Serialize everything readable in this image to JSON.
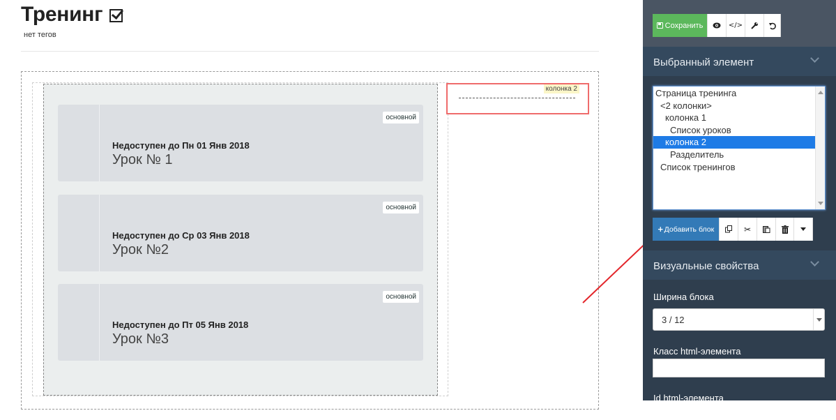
{
  "page": {
    "title": "Тренинг",
    "tags": "нет тегов"
  },
  "lessons": [
    {
      "badge": "основной",
      "status": "Недоступен до Пн 01 Янв 2018",
      "name": "Урок № 1"
    },
    {
      "badge": "основной",
      "status": "Недоступен до Ср 03 Янв 2018",
      "name": "Урок №2"
    },
    {
      "badge": "основной",
      "status": "Недоступен до Пт 05 Янв 2018",
      "name": "Урок №3"
    }
  ],
  "column2": {
    "tag": "колонка 2"
  },
  "toolbar": {
    "save_label": "Сохранить",
    "icons": [
      "eye-icon",
      "code-icon",
      "wrench-icon",
      "undo-icon"
    ]
  },
  "selected_element": {
    "title": "Выбранный элемент",
    "tree": [
      {
        "label": "Страница тренинга",
        "depth": 0,
        "selected": false
      },
      {
        "label": "<2 колонки>",
        "depth": 1,
        "selected": false
      },
      {
        "label": "колонка 1",
        "depth": 2,
        "selected": false
      },
      {
        "label": "Список уроков",
        "depth": 3,
        "selected": false
      },
      {
        "label": "колонка 2",
        "depth": 2,
        "selected": true
      },
      {
        "label": "Разделитель",
        "depth": 3,
        "selected": false
      },
      {
        "label": "Список тренингов",
        "depth": 1,
        "selected": false
      }
    ],
    "add_block_label": "Добавить блок",
    "block_icons": [
      "copy-icon",
      "scissors-icon",
      "paste-icon",
      "trash-icon",
      "caret-down-icon"
    ]
  },
  "visual_props": {
    "title": "Визуальные свойства",
    "width_label": "Ширина блока",
    "width_value": "3 / 12",
    "class_label": "Класс html-элемента",
    "class_value": "",
    "id_label": "Id html-элемента"
  },
  "colors": {
    "panel_bg": "#2f3e4e",
    "save_green": "#5cb85c",
    "add_blue": "#337ab7",
    "selection_blue": "#1e7be6",
    "column2_border": "#ef6b6b",
    "arrow_red": "#e3262b"
  }
}
